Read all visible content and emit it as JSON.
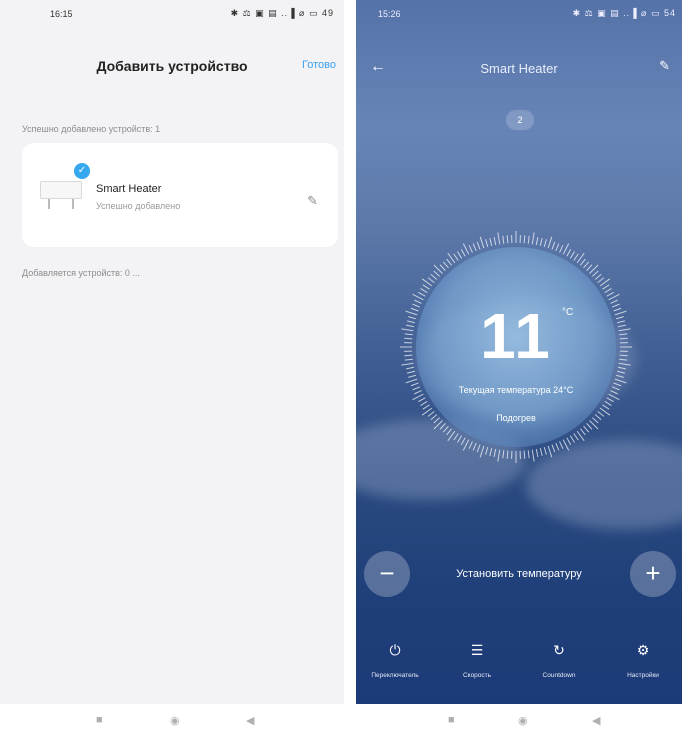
{
  "left_screen": {
    "status_bar": {
      "time": "16:15",
      "icons": "✱ ⚖ ▣ ▤ ..▐ ⌀ ▭ 49"
    },
    "title": "Добавить устройство",
    "done_label": "Готово",
    "added_label": "Успешно добавлено устройств: 1",
    "device": {
      "name": "Smart Heater",
      "status": "Успешно добавлено",
      "check_icon": "check-icon",
      "edit_icon": "pencil-icon"
    },
    "adding_label": "Добавляется устройств: 0 ..."
  },
  "right_screen": {
    "status_bar": {
      "time": "15:26",
      "icons": "✱ ⚖ ▣ ▤ ..▐ ⌀ ▭ 54"
    },
    "title": "Smart Heater",
    "level_badge": "2",
    "temperature": "11",
    "temperature_unit": "°C",
    "current_temperature": "Текущая температура 24°C",
    "mode": "Подогрев",
    "set_temperature_label": "Установить температуру",
    "minus_label": "−",
    "plus_label": "+",
    "bottom_items": [
      {
        "icon": "power-icon",
        "glyph": "⏻",
        "label": "Переключатель"
      },
      {
        "icon": "speed-icon",
        "glyph": "☰",
        "label": "Скорость"
      },
      {
        "icon": "countdown-icon",
        "glyph": "↻",
        "label": "Countdown"
      },
      {
        "icon": "settings-icon",
        "glyph": "⚙",
        "label": "Настройки"
      }
    ]
  },
  "system_nav": {
    "recent": "■",
    "home": "◉",
    "back": "◀"
  },
  "colors": {
    "accent": "#3aa0f2",
    "check": "#35a8f0",
    "bg_right": "#2b4a80"
  }
}
